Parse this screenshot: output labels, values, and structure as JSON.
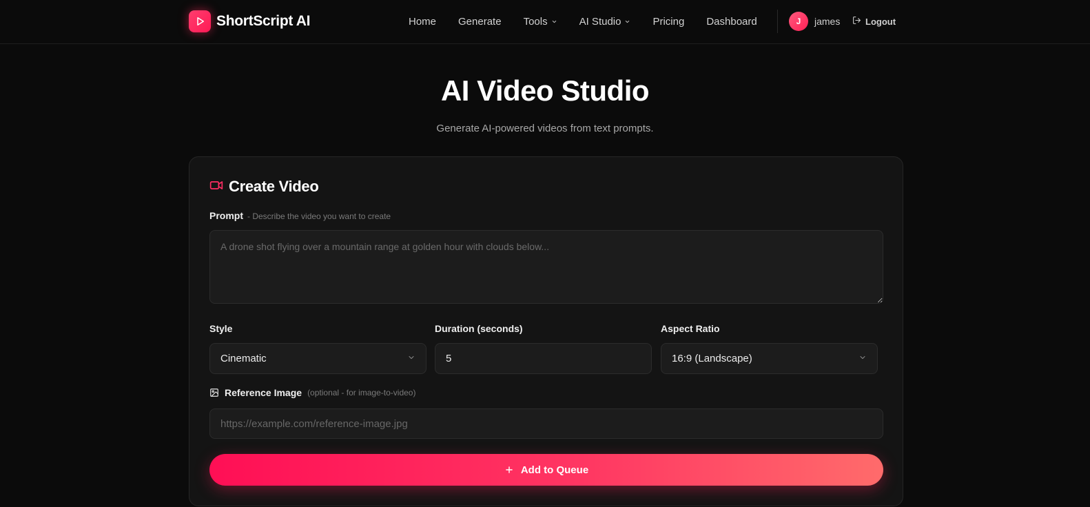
{
  "brand": {
    "name": "ShortScript AI",
    "accent": "#ff1f5a"
  },
  "nav": {
    "items": [
      {
        "label": "Home",
        "dropdown": false
      },
      {
        "label": "Generate",
        "dropdown": false
      },
      {
        "label": "Tools",
        "dropdown": true
      },
      {
        "label": "AI Studio",
        "dropdown": true
      },
      {
        "label": "Pricing",
        "dropdown": false
      },
      {
        "label": "Dashboard",
        "dropdown": false
      }
    ],
    "user": {
      "initial": "J",
      "name": "james"
    },
    "logout_label": "Logout"
  },
  "hero": {
    "title": "AI Video Studio",
    "subtitle": "Generate AI-powered videos from text prompts."
  },
  "form": {
    "title": "Create Video",
    "title_icon": "video-camera-icon",
    "prompt": {
      "label": "Prompt",
      "hint": "- Describe the video you want to create",
      "placeholder": "A drone shot flying over a mountain range at golden hour with clouds below...",
      "value": ""
    },
    "style": {
      "label": "Style",
      "value": "Cinematic"
    },
    "duration": {
      "label": "Duration (seconds)",
      "value": "5"
    },
    "aspect_ratio": {
      "label": "Aspect Ratio",
      "value": "16:9 (Landscape)"
    },
    "reference_image": {
      "label": "Reference Image",
      "hint": "(optional - for image-to-video)",
      "placeholder": "https://example.com/reference-image.jpg",
      "value": ""
    },
    "submit_label": "Add to Queue"
  }
}
